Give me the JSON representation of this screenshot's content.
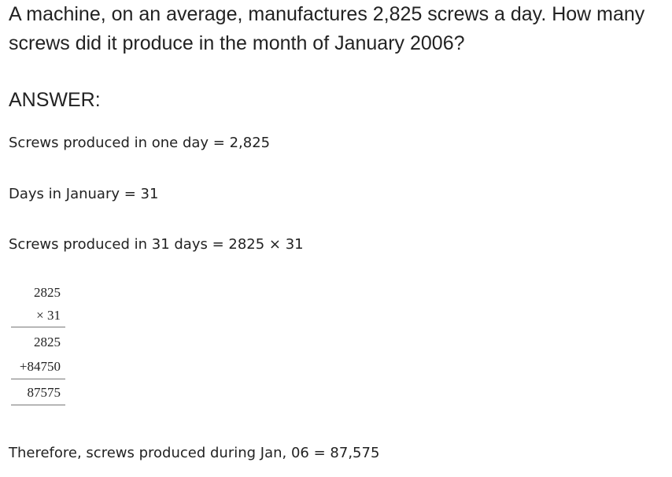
{
  "question": {
    "text": "A machine, on an average, manufactures 2,825 screws a day. How many screws did it produce in the month of January 2006?"
  },
  "answer": {
    "heading": "ANSWER:",
    "steps": [
      "Screws produced in one day = 2,825",
      "Days in January = 31",
      "Screws produced in 31 days = 2825 × 31"
    ],
    "calculation": {
      "multiplicand": "2825",
      "multiplier": "× 31",
      "partial_product_1": "2825",
      "partial_product_2": "+84750",
      "product": "87575"
    },
    "conclusion": "Therefore, screws produced during Jan, 06 = 87,575"
  }
}
